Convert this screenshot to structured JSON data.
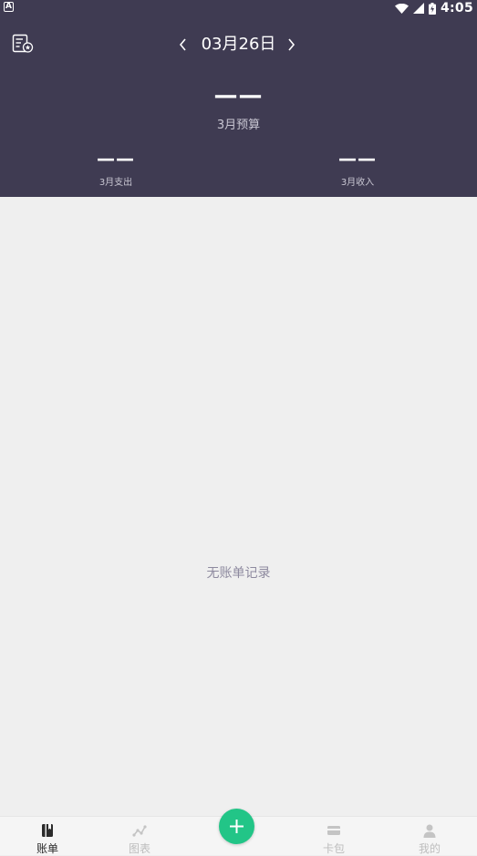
{
  "status_bar": {
    "time": "4:05",
    "icons": [
      "notification-a-icon",
      "wifi-icon",
      "signal-icon",
      "battery-icon"
    ]
  },
  "header": {
    "date": "03月26日",
    "budget": {
      "value": "——",
      "label": "3月预算"
    },
    "expense": {
      "value": "——",
      "label": "3月支出"
    },
    "income": {
      "value": "——",
      "label": "3月收入"
    },
    "colors": {
      "background": "#3f3b52"
    }
  },
  "main": {
    "empty_text": "无账单记录"
  },
  "bottom_nav": {
    "tabs": [
      {
        "label": "账单",
        "icon": "book-icon",
        "active": true
      },
      {
        "label": "图表",
        "icon": "chart-icon",
        "active": false
      },
      {
        "label": "卡包",
        "icon": "card-icon",
        "active": false
      },
      {
        "label": "我的",
        "icon": "person-icon",
        "active": false
      }
    ],
    "fab_icon": "plus-icon",
    "colors": {
      "fab": "#22c587",
      "active": "#2b2b2b",
      "inactive": "#bdbdbd"
    }
  }
}
